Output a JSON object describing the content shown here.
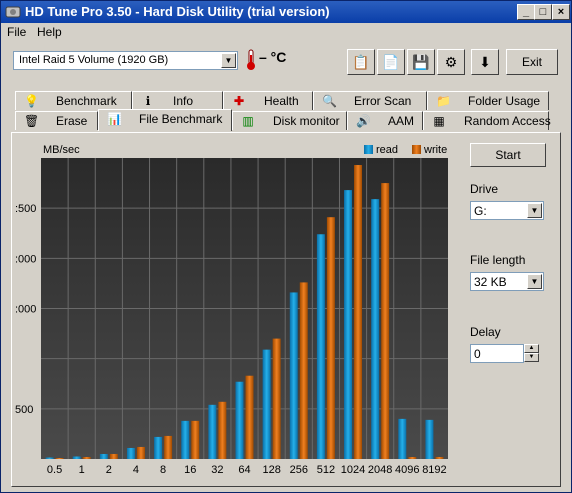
{
  "title": "HD Tune Pro 3.50 - Hard Disk Utility (trial version)",
  "window_buttons": {
    "minimize": "_",
    "maximize": "□",
    "close": "×"
  },
  "menu": [
    "File",
    "Help"
  ],
  "toolbar": {
    "drive": "Intel   Raid 5 Volume (1920 GB)",
    "temperature": "– °C",
    "exit_label": "Exit"
  },
  "tabs_top": [
    {
      "label": "Benchmark",
      "icon": "lightbulb-icon"
    },
    {
      "label": "Info",
      "icon": "info-icon"
    },
    {
      "label": "Health",
      "icon": "health-cross-icon"
    },
    {
      "label": "Error Scan",
      "icon": "magnifier-icon"
    },
    {
      "label": "Folder Usage",
      "icon": "folder-icon"
    }
  ],
  "tabs_bottom": [
    {
      "label": "Erase",
      "icon": "trash-icon"
    },
    {
      "label": "File Benchmark",
      "icon": "file-benchmark-icon",
      "active": true
    },
    {
      "label": "Disk monitor",
      "icon": "disk-monitor-icon"
    },
    {
      "label": "AAM",
      "icon": "speaker-icon"
    },
    {
      "label": "Random Access",
      "icon": "random-access-icon"
    }
  ],
  "side": {
    "start_label": "Start",
    "drive_label": "Drive",
    "drive_value": "G:",
    "file_length_label": "File length",
    "file_length_value": "32 KB",
    "delay_label": "Delay",
    "delay_value": "0"
  },
  "chart_data": {
    "type": "bar",
    "ylabel": "MB/sec",
    "ytick_labels": [
      ":500",
      ":000",
      ":000",
      "500"
    ],
    "yticks": [
      2500,
      2000,
      1500,
      500
    ],
    "ylim": [
      0,
      3000
    ],
    "categories": [
      "0.5",
      "1",
      "2",
      "4",
      "8",
      "16",
      "32",
      "64",
      "128",
      "256",
      "512",
      "1024",
      "2048",
      "4096",
      "8192"
    ],
    "series": [
      {
        "name": "read",
        "color": "#1e9fd6",
        "values": [
          15,
          25,
          50,
          110,
          220,
          380,
          540,
          770,
          1090,
          1660,
          2240,
          2680,
          2590,
          400,
          390
        ]
      },
      {
        "name": "write",
        "color": "#e07010",
        "values": [
          10,
          20,
          50,
          120,
          230,
          380,
          570,
          830,
          1200,
          1760,
          2410,
          2930,
          2750,
          20,
          20
        ]
      }
    ],
    "legend": "top-right",
    "grid": true
  }
}
